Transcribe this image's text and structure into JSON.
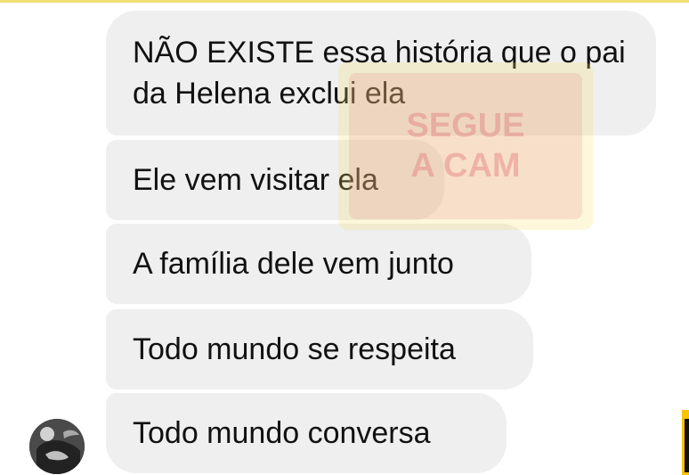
{
  "messages": [
    "NÃO EXISTE essa história que o pai da Helena exclui ela",
    "Ele vem visitar ela",
    "A família dele vem junto",
    "Todo mundo se respeita",
    "Todo mundo conversa"
  ],
  "watermark": {
    "line1": "SEGUE",
    "line2": "A CAM",
    "colors": {
      "outer": "#f6df62",
      "inner": "#e88d8d",
      "text": "#e27d7d"
    }
  },
  "avatar": {
    "icon": "user-photo-avatar"
  },
  "colors": {
    "bubble": "#efefef",
    "text": "#111111",
    "background": "#ffffff",
    "top_line": "#f1dd72",
    "edge_yellow": "#f6c400"
  }
}
